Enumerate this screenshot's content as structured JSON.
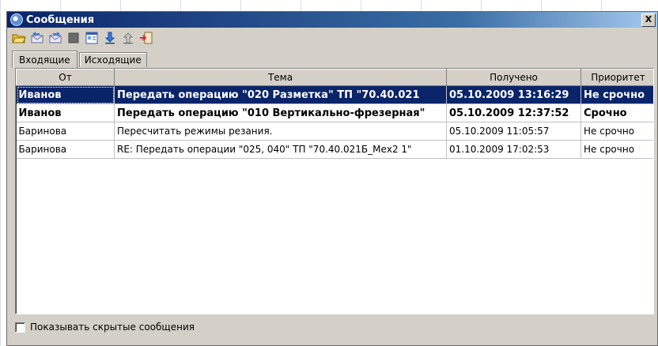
{
  "window": {
    "title": "Сообщения",
    "close_label": "X"
  },
  "toolbar": {
    "buttons": [
      {
        "icon": "open-folder-icon"
      },
      {
        "icon": "reply-icon"
      },
      {
        "icon": "forward-icon"
      },
      {
        "icon": "stop-icon"
      },
      {
        "icon": "properties-icon"
      },
      {
        "icon": "arrow-down-icon"
      },
      {
        "icon": "arrow-up-icon"
      },
      {
        "icon": "exit-icon"
      }
    ]
  },
  "tabs": [
    {
      "label": "Входящие",
      "active": true
    },
    {
      "label": "Исходящие",
      "active": false
    }
  ],
  "table": {
    "columns": [
      "От",
      "Тема",
      "Получено",
      "Приоритет"
    ],
    "rows": [
      {
        "from": "Иванов",
        "subject": "Передать операцию \"020 Разметка\" ТП \"70.40.021",
        "received": "05.10.2009 13:16:29",
        "priority": "Не срочно",
        "bold": true,
        "selected": true
      },
      {
        "from": "Иванов",
        "subject": "Передать операцию \"010 Вертикально-фрезерная\"",
        "received": "05.10.2009 12:37:52",
        "priority": "Срочно",
        "bold": true,
        "selected": false
      },
      {
        "from": "Баринова",
        "subject": "Пересчитать режимы резания.",
        "received": "05.10.2009 11:05:57",
        "priority": "Не срочно",
        "bold": false,
        "selected": false
      },
      {
        "from": "Баринова",
        "subject": "RE: Передать операции \"025, 040\" ТП \"70.40.021Б_Мех2 1\"",
        "received": "01.10.2009 17:02:53",
        "priority": "Не срочно",
        "bold": false,
        "selected": false
      }
    ]
  },
  "footer": {
    "show_hidden_label": "Показывать скрытые сообщения",
    "show_hidden_checked": false
  },
  "colors": {
    "title_bar": "#0a246a",
    "selection": "#0a246a",
    "face": "#d4d0c8"
  }
}
